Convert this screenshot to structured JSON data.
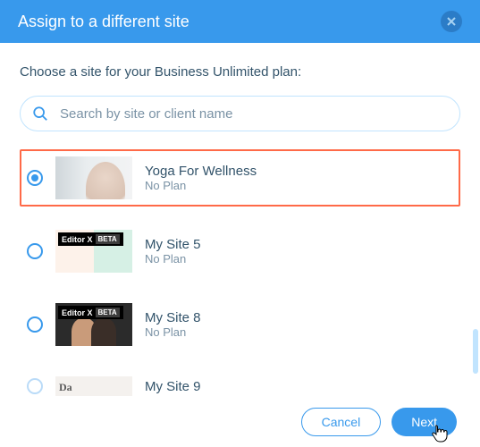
{
  "header": {
    "title": "Assign to a different site"
  },
  "body": {
    "prompt": "Choose a site for your Business Unlimited plan:",
    "search": {
      "placeholder": "Search by site or client name"
    }
  },
  "sites": [
    {
      "name": "Yoga For Wellness",
      "plan": "No Plan",
      "selected": true,
      "badge": null,
      "thumb": "yoga"
    },
    {
      "name": "My Site 5",
      "plan": "No Plan",
      "selected": false,
      "badge": {
        "label": "Editor X",
        "tag": "BETA"
      },
      "thumb": "site5"
    },
    {
      "name": "My Site 8",
      "plan": "No Plan",
      "selected": false,
      "badge": {
        "label": "Editor X",
        "tag": "BETA"
      },
      "thumb": "site8"
    },
    {
      "name": "My Site 9",
      "plan": "",
      "selected": false,
      "badge": null,
      "thumb": "site9"
    }
  ],
  "thumb_preview_text": {
    "site9": "Da"
  },
  "footer": {
    "cancel": "Cancel",
    "next": "Next"
  }
}
